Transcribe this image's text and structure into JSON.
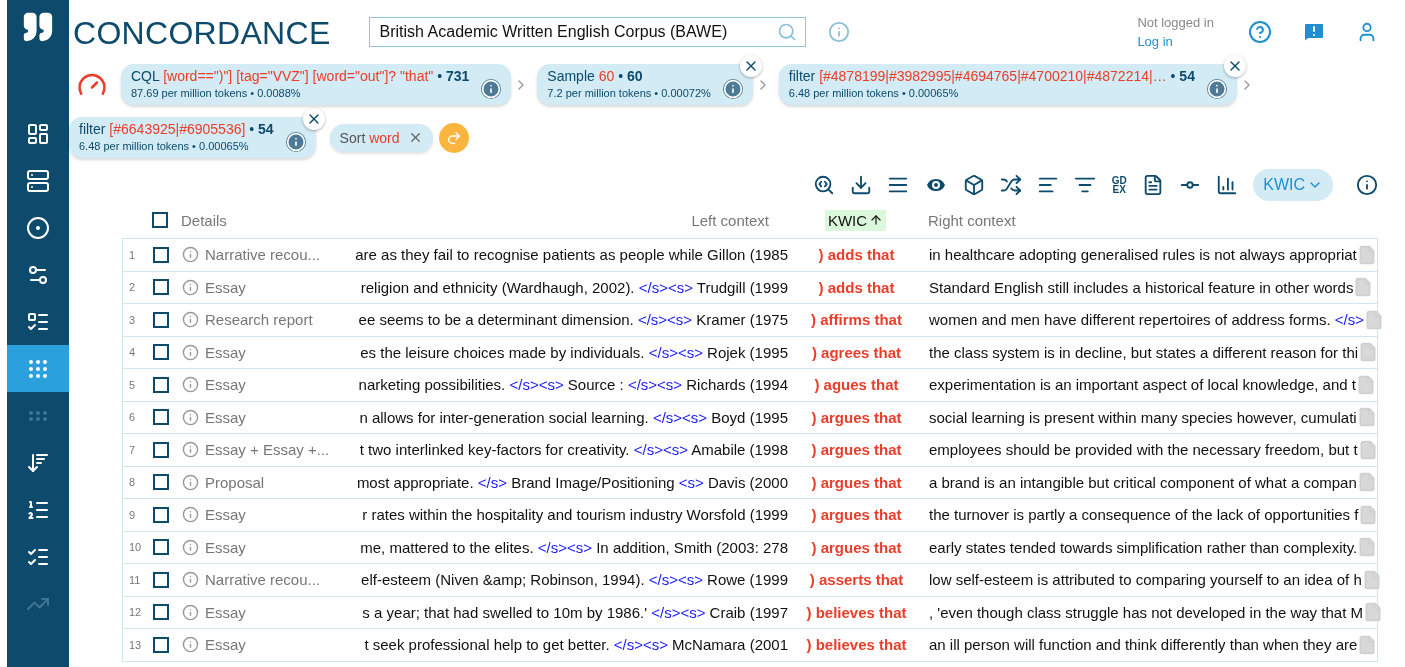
{
  "app": {
    "title": "CONCORDANCE"
  },
  "sidebar": {
    "items": [
      {
        "selected": false,
        "disabled": false
      },
      {
        "selected": false,
        "disabled": false
      },
      {
        "selected": false,
        "disabled": false
      },
      {
        "selected": false,
        "disabled": false
      },
      {
        "selected": false,
        "disabled": false
      },
      {
        "selected": true,
        "disabled": false
      },
      {
        "selected": false,
        "disabled": true
      },
      {
        "selected": false,
        "disabled": false
      },
      {
        "selected": false,
        "disabled": false
      },
      {
        "selected": false,
        "disabled": false
      },
      {
        "selected": false,
        "disabled": true
      }
    ]
  },
  "corpus_field": {
    "value": "British Academic Written English Corpus (BAWE)"
  },
  "user": {
    "status": "Not logged in",
    "login_link": "Log in"
  },
  "query_chain": [
    {
      "label": "CQL",
      "query": "[word==\")\"] [tag=\"VVZ\"] [word=\"out\"]? \"that\"",
      "count": "• **731**",
      "stats": "87.69 per million tokens • 0.0088%",
      "closable": false
    },
    {
      "label": "Sample",
      "query": "60",
      "count": "• **60**",
      "stats": "7.2 per million tokens • 0.00072%",
      "closable": true
    },
    {
      "label": "filter",
      "query": "[#4878199|#3982995|#4694765|#4700210|#4872214|…",
      "count": "• **54**",
      "stats": "6.48 per million tokens • 0.00065%",
      "closable": true
    },
    {
      "label": "filter",
      "query": "[#6643925|#6905536]",
      "count": "• **54**",
      "stats": "6.48 per million tokens • 0.00065%",
      "closable": true
    }
  ],
  "sort_chip": {
    "label": "Sort",
    "value": "word"
  },
  "toolbar": {
    "gdex_label": "GD EX",
    "view": "KWIC"
  },
  "table": {
    "columns": {
      "details": "Details",
      "left": "Left context",
      "kwic": "KWIC",
      "right": "Right context"
    },
    "kwic_sorted": true,
    "all_checked": false,
    "rows": [
      {
        "n": "1",
        "checked": false,
        "detail": "Narrative recou...",
        "left": [
          {
            "kind": "text",
            "t": "are as they fail to recognise patients as people while Gillon (1985"
          }
        ],
        "kwic": ") adds that",
        "right": [
          {
            "kind": "text",
            "t": "in healthcare adopting generalised rules is not always appropriat"
          }
        ]
      },
      {
        "n": "2",
        "checked": false,
        "detail": "Essay",
        "left": [
          {
            "kind": "text",
            "t": "religion and ethnicity (Wardhaugh, 2002). "
          },
          {
            "kind": "tag",
            "t": "</s><s>"
          },
          {
            "kind": "text",
            "t": " Trudgill (1999"
          }
        ],
        "kwic": ") adds that",
        "right": [
          {
            "kind": "text",
            "t": "Standard English still includes a historical feature in other words"
          }
        ]
      },
      {
        "n": "3",
        "checked": false,
        "detail": "Research report",
        "left": [
          {
            "kind": "text",
            "t": "ee seems to be a determinant dimension. "
          },
          {
            "kind": "tag",
            "t": "</s><s>"
          },
          {
            "kind": "text",
            "t": " Kramer (1975"
          }
        ],
        "kwic": ") affirms that",
        "right": [
          {
            "kind": "text",
            "t": "women and men have different repertoires of address forms. "
          },
          {
            "kind": "tag",
            "t": "</s>"
          }
        ]
      },
      {
        "n": "4",
        "checked": false,
        "detail": "Essay",
        "left": [
          {
            "kind": "text",
            "t": "es the leisure choices made by individuals. "
          },
          {
            "kind": "tag",
            "t": "</s><s>"
          },
          {
            "kind": "text",
            "t": " Rojek (1995"
          }
        ],
        "kwic": ") agrees that",
        "right": [
          {
            "kind": "text",
            "t": "the class system is in decline, but states a different reason for thi"
          }
        ]
      },
      {
        "n": "5",
        "checked": false,
        "detail": "Essay",
        "left": [
          {
            "kind": "text",
            "t": "narketing possibilities. "
          },
          {
            "kind": "tag",
            "t": "</s><s>"
          },
          {
            "kind": "text",
            "t": " Source : "
          },
          {
            "kind": "tag",
            "t": "</s><s>"
          },
          {
            "kind": "text",
            "t": " Richards (1994"
          }
        ],
        "kwic": ") agues that",
        "right": [
          {
            "kind": "text",
            "t": "experimentation is an important aspect of local knowledge, and t"
          }
        ]
      },
      {
        "n": "6",
        "checked": false,
        "detail": "Essay",
        "left": [
          {
            "kind": "text",
            "t": "n allows for inter-generation social learning. "
          },
          {
            "kind": "tag",
            "t": "</s><s>"
          },
          {
            "kind": "text",
            "t": " Boyd (1995"
          }
        ],
        "kwic": ") argues that",
        "right": [
          {
            "kind": "text",
            "t": "social learning is present within many species however, cumulati"
          }
        ]
      },
      {
        "n": "7",
        "checked": false,
        "detail": "Essay + Essay +...",
        "left": [
          {
            "kind": "text",
            "t": "t two interlinked key-factors for creativity. "
          },
          {
            "kind": "tag",
            "t": "</s><s>"
          },
          {
            "kind": "text",
            "t": " Amabile (1998"
          }
        ],
        "kwic": ") argues that",
        "right": [
          {
            "kind": "text",
            "t": "employees should be provided with the necessary freedom, but t"
          }
        ]
      },
      {
        "n": "8",
        "checked": false,
        "detail": "Proposal",
        "left": [
          {
            "kind": "text",
            "t": "most appropriate. "
          },
          {
            "kind": "tag",
            "t": "</s>"
          },
          {
            "kind": "text",
            "t": " Brand Image/Positioning "
          },
          {
            "kind": "tag",
            "t": "<s>"
          },
          {
            "kind": "text",
            "t": " Davis (2000"
          }
        ],
        "kwic": ") argues that",
        "right": [
          {
            "kind": "text",
            "t": "a brand is an intangible but critical component of what a compan"
          }
        ]
      },
      {
        "n": "9",
        "checked": false,
        "detail": "Essay",
        "left": [
          {
            "kind": "text",
            "t": "r rates within the hospitality and tourism industry Worsfold (1999"
          }
        ],
        "kwic": ") argues that",
        "right": [
          {
            "kind": "text",
            "t": "the turnover is partly a consequence of the lack of opportunities f"
          }
        ]
      },
      {
        "n": "10",
        "checked": false,
        "detail": "Essay",
        "left": [
          {
            "kind": "text",
            "t": "me, mattered to the elites. "
          },
          {
            "kind": "tag",
            "t": "</s><s>"
          },
          {
            "kind": "text",
            "t": " In addition, Smith (2003: 278"
          }
        ],
        "kwic": ") argues that",
        "right": [
          {
            "kind": "text",
            "t": "early states tended towards simplification rather than complexity."
          }
        ]
      },
      {
        "n": "11",
        "checked": false,
        "detail": "Narrative recou...",
        "left": [
          {
            "kind": "text",
            "t": "elf-esteem (Niven &amp; Robinson, 1994). "
          },
          {
            "kind": "tag",
            "t": "</s><s>"
          },
          {
            "kind": "text",
            "t": " Rowe (1999"
          }
        ],
        "kwic": ") asserts that",
        "right": [
          {
            "kind": "text",
            "t": "low self-esteem is attributed to comparing yourself to an idea of h"
          }
        ]
      },
      {
        "n": "12",
        "checked": false,
        "detail": "Essay",
        "left": [
          {
            "kind": "text",
            "t": "s a year; that had swelled to 10m by 1986.' "
          },
          {
            "kind": "tag",
            "t": "</s><s>"
          },
          {
            "kind": "text",
            "t": " Craib (1997"
          }
        ],
        "kwic": ") believes that",
        "right": [
          {
            "kind": "text",
            "t": ", 'even though class struggle has not developed in the way that M"
          }
        ]
      },
      {
        "n": "13",
        "checked": false,
        "detail": "Essay",
        "left": [
          {
            "kind": "text",
            "t": "t seek professional help to get better. "
          },
          {
            "kind": "tag",
            "t": "</s><s>"
          },
          {
            "kind": "text",
            "t": " McNamara (2001"
          }
        ],
        "kwic": ") believes that",
        "right": [
          {
            "kind": "text",
            "t": "an ill person will function and think differently than when they are"
          }
        ]
      }
    ]
  }
}
